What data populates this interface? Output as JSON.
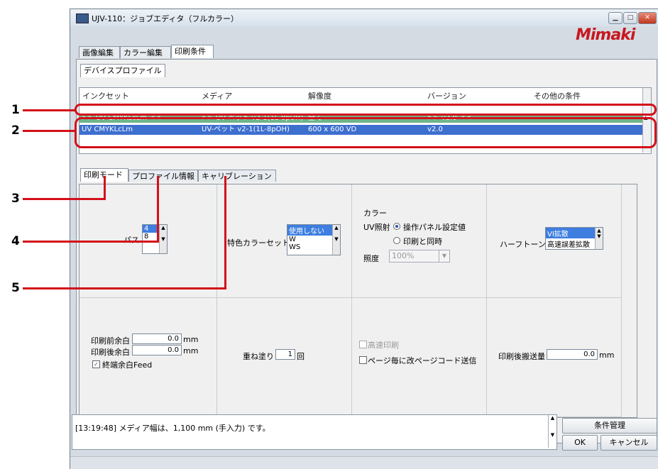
{
  "window": {
    "title": "UJV-110：ジョブエディタ（フルカラー）",
    "logo_text": "Mimaki"
  },
  "main_tabs": [
    "画像編集",
    "カラー編集",
    "印刷条件"
  ],
  "profile_tab": "デバイスプロファイル",
  "table": {
    "headers": [
      "インクセット",
      "メディア",
      "解像度",
      "バージョン",
      "その他の条件"
    ],
    "row_current": [
      ">> UV CMYKLcLm <<",
      ">> UV-ペット v2-1(1L-8pUH)",
      "全て",
      ">> v2.0 <<",
      ""
    ],
    "row_selected": [
      "UV CMYKLcLm",
      "UV-ペット v2-1(1L-8pOH)",
      "600 x 600 VD",
      "v2.0",
      ""
    ]
  },
  "sub_tabs": [
    "印刷モード",
    "プロファイル情報",
    "キャリブレーション"
  ],
  "pass": {
    "label": "パス",
    "options": [
      "4",
      "8"
    ]
  },
  "special_color": {
    "label": "特色カラーセット",
    "options": [
      "使用しない",
      "W",
      "WS"
    ]
  },
  "color_group": {
    "heading": "カラー",
    "uv_label": "UV照射",
    "radio1": "操作パネル設定値",
    "radio2": "印刷と同時",
    "intensity_label": "照度",
    "intensity_value": "100%"
  },
  "halftone": {
    "label": "ハーフトーン",
    "options": [
      "VI拡散",
      "高速誤差拡散"
    ]
  },
  "margins": {
    "front_label": "印刷前余白",
    "front_value": "0.0",
    "back_label": "印刷後余白",
    "back_value": "0.0",
    "unit": "mm",
    "feed_label": "終端余白Feed"
  },
  "overprint": {
    "label": "重ね塗り",
    "value": "1",
    "unit": "回"
  },
  "options": {
    "high_speed": "高速印刷",
    "page_code": "ページ毎に改ページコード送信"
  },
  "post_feed": {
    "label": "印刷後搬送量",
    "value": "0.0",
    "unit": "mm"
  },
  "log_text": "[13:19:48] メディア幅は、1,100 mm (手入力) です。",
  "buttons": {
    "manage": "条件管理",
    "ok": "OK",
    "cancel": "キャンセル"
  },
  "callouts": [
    "1",
    "2",
    "3",
    "4",
    "5"
  ],
  "colors": {
    "callout_red": "#d3101a",
    "selection": "#3d6fcf",
    "current_row": "#6fb48a"
  }
}
